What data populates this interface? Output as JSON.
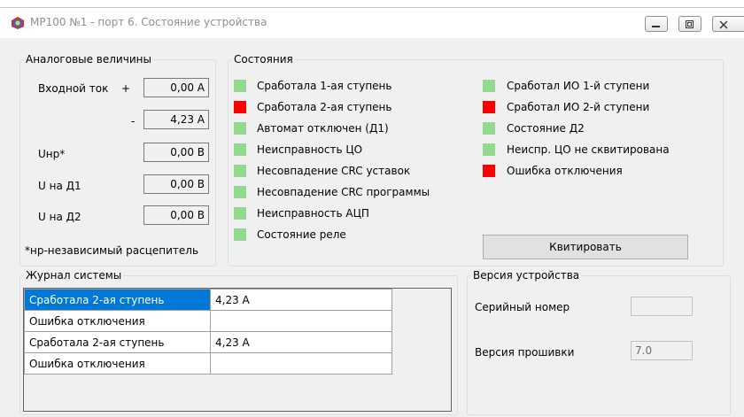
{
  "window": {
    "title": "МР100 №1 - порт 6. Состояние устройства",
    "icon": "device-icon",
    "controls": [
      "minimize-icon",
      "restore-icon",
      "close-icon"
    ]
  },
  "analog": {
    "legend": "Аналоговые величины",
    "rows": [
      {
        "label": "Входной ток",
        "sign": "+",
        "value": "0,00 А"
      },
      {
        "label": "",
        "sign": "-",
        "value": "4,23 А"
      },
      {
        "label": "Uнр*",
        "sign": "",
        "value": "0,00 В"
      },
      {
        "label": "U на Д1",
        "sign": "",
        "value": "0,00 В"
      },
      {
        "label": "U на Д2",
        "sign": "",
        "value": "0,00 В"
      }
    ],
    "footnote": "*нр-независимый расцепитель"
  },
  "states": {
    "legend": "Состояния",
    "left": [
      {
        "label": "Сработала 1-ая ступень",
        "color": "#92d88f"
      },
      {
        "label": "Сработала 2-ая ступень",
        "color": "#ff0000"
      },
      {
        "label": "Автомат отключен (Д1)",
        "color": "#92d88f"
      },
      {
        "label": "Неисправность ЦО",
        "color": "#92d88f"
      },
      {
        "label": "Несовпадение CRC уставок",
        "color": "#92d88f"
      },
      {
        "label": "Несовпадение CRC программы",
        "color": "#92d88f"
      },
      {
        "label": "Неисправность АЦП",
        "color": "#92d88f"
      },
      {
        "label": "Состояние реле",
        "color": "#92d88f"
      }
    ],
    "right": [
      {
        "label": "Сработал ИО 1-й ступени",
        "color": "#92d88f"
      },
      {
        "label": "Сработал ИО 2-й ступени",
        "color": "#ff0000"
      },
      {
        "label": "Состояние Д2",
        "color": "#92d88f"
      },
      {
        "label": "Неиспр. ЦО не сквитирована",
        "color": "#92d88f"
      },
      {
        "label": "Ошибка отключения",
        "color": "#ff0000"
      }
    ],
    "ack_button": "Квитировать"
  },
  "journal": {
    "legend": "Журнал системы",
    "rows": [
      {
        "event": "Сработала 2-ая ступень",
        "value": "4,23 А"
      },
      {
        "event": "Ошибка отключения",
        "value": ""
      },
      {
        "event": "Сработала 2-ая ступень",
        "value": "4,23 А"
      },
      {
        "event": "Ошибка отключения",
        "value": ""
      }
    ]
  },
  "version": {
    "legend": "Версия устройства",
    "serial_label": "Серийный номер",
    "serial_value": "",
    "firmware_label": "Версия прошивки",
    "firmware_value": "7.0"
  }
}
